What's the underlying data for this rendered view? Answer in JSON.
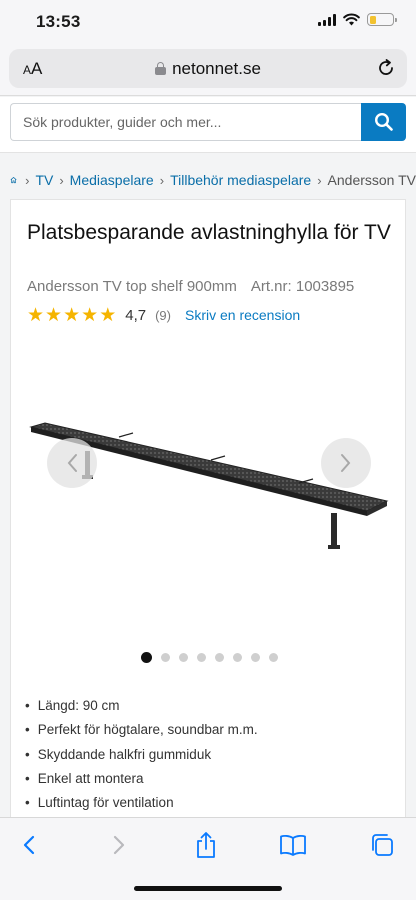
{
  "status_bar": {
    "time": "13:53",
    "battery_level": 0.3
  },
  "browser": {
    "aa_label_small": "A",
    "aa_label_large": "A",
    "url": "netonnet.se"
  },
  "search": {
    "placeholder": "Sök produkter, guider och mer..."
  },
  "breadcrumb": [
    {
      "label": "TV"
    },
    {
      "label": "Mediaspelare"
    },
    {
      "label": "Tillbehör mediaspelare"
    },
    {
      "label": "Andersson TV"
    }
  ],
  "product": {
    "title": "Platsbesparande avlastninghylla för TV",
    "model": "Andersson TV top shelf 900mm",
    "article": "Art.nr: 1003895",
    "rating": {
      "stars": 5,
      "value": "4,7",
      "count": "(9)",
      "review_link": "Skriv en recension"
    },
    "image_count": 8,
    "active_image": 0,
    "features": [
      "Längd: 90 cm",
      "Perfekt för högtalare, soundbar m.m.",
      "Skyddande halkfri gummiduk",
      "Enkel att montera",
      "Luftintag för ventilation"
    ]
  },
  "colors": {
    "accent_blue": "#0a7bc2",
    "link_blue": "#0a6ea8",
    "star_yellow": "#f5b400",
    "ios_blue": "#0a7aff"
  }
}
